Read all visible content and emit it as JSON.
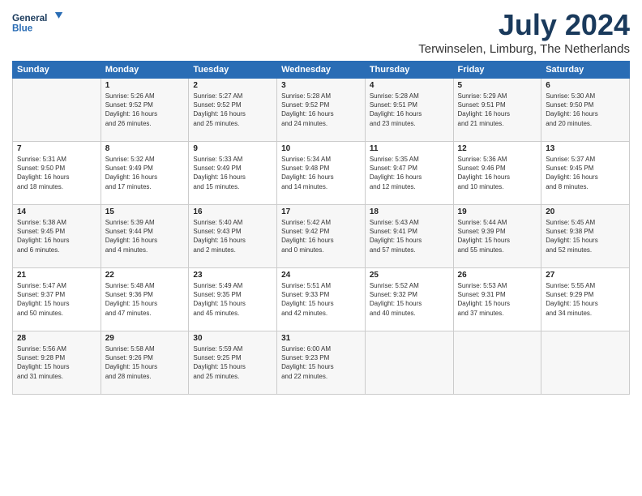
{
  "logo": {
    "line1": "General",
    "line2": "Blue"
  },
  "title": "July 2024",
  "subtitle": "Terwinselen, Limburg, The Netherlands",
  "weekdays": [
    "Sunday",
    "Monday",
    "Tuesday",
    "Wednesday",
    "Thursday",
    "Friday",
    "Saturday"
  ],
  "weeks": [
    [
      {
        "day": "",
        "content": ""
      },
      {
        "day": "1",
        "content": "Sunrise: 5:26 AM\nSunset: 9:52 PM\nDaylight: 16 hours\nand 26 minutes."
      },
      {
        "day": "2",
        "content": "Sunrise: 5:27 AM\nSunset: 9:52 PM\nDaylight: 16 hours\nand 25 minutes."
      },
      {
        "day": "3",
        "content": "Sunrise: 5:28 AM\nSunset: 9:52 PM\nDaylight: 16 hours\nand 24 minutes."
      },
      {
        "day": "4",
        "content": "Sunrise: 5:28 AM\nSunset: 9:51 PM\nDaylight: 16 hours\nand 23 minutes."
      },
      {
        "day": "5",
        "content": "Sunrise: 5:29 AM\nSunset: 9:51 PM\nDaylight: 16 hours\nand 21 minutes."
      },
      {
        "day": "6",
        "content": "Sunrise: 5:30 AM\nSunset: 9:50 PM\nDaylight: 16 hours\nand 20 minutes."
      }
    ],
    [
      {
        "day": "7",
        "content": "Sunrise: 5:31 AM\nSunset: 9:50 PM\nDaylight: 16 hours\nand 18 minutes."
      },
      {
        "day": "8",
        "content": "Sunrise: 5:32 AM\nSunset: 9:49 PM\nDaylight: 16 hours\nand 17 minutes."
      },
      {
        "day": "9",
        "content": "Sunrise: 5:33 AM\nSunset: 9:49 PM\nDaylight: 16 hours\nand 15 minutes."
      },
      {
        "day": "10",
        "content": "Sunrise: 5:34 AM\nSunset: 9:48 PM\nDaylight: 16 hours\nand 14 minutes."
      },
      {
        "day": "11",
        "content": "Sunrise: 5:35 AM\nSunset: 9:47 PM\nDaylight: 16 hours\nand 12 minutes."
      },
      {
        "day": "12",
        "content": "Sunrise: 5:36 AM\nSunset: 9:46 PM\nDaylight: 16 hours\nand 10 minutes."
      },
      {
        "day": "13",
        "content": "Sunrise: 5:37 AM\nSunset: 9:45 PM\nDaylight: 16 hours\nand 8 minutes."
      }
    ],
    [
      {
        "day": "14",
        "content": "Sunrise: 5:38 AM\nSunset: 9:45 PM\nDaylight: 16 hours\nand 6 minutes."
      },
      {
        "day": "15",
        "content": "Sunrise: 5:39 AM\nSunset: 9:44 PM\nDaylight: 16 hours\nand 4 minutes."
      },
      {
        "day": "16",
        "content": "Sunrise: 5:40 AM\nSunset: 9:43 PM\nDaylight: 16 hours\nand 2 minutes."
      },
      {
        "day": "17",
        "content": "Sunrise: 5:42 AM\nSunset: 9:42 PM\nDaylight: 16 hours\nand 0 minutes."
      },
      {
        "day": "18",
        "content": "Sunrise: 5:43 AM\nSunset: 9:41 PM\nDaylight: 15 hours\nand 57 minutes."
      },
      {
        "day": "19",
        "content": "Sunrise: 5:44 AM\nSunset: 9:39 PM\nDaylight: 15 hours\nand 55 minutes."
      },
      {
        "day": "20",
        "content": "Sunrise: 5:45 AM\nSunset: 9:38 PM\nDaylight: 15 hours\nand 52 minutes."
      }
    ],
    [
      {
        "day": "21",
        "content": "Sunrise: 5:47 AM\nSunset: 9:37 PM\nDaylight: 15 hours\nand 50 minutes."
      },
      {
        "day": "22",
        "content": "Sunrise: 5:48 AM\nSunset: 9:36 PM\nDaylight: 15 hours\nand 47 minutes."
      },
      {
        "day": "23",
        "content": "Sunrise: 5:49 AM\nSunset: 9:35 PM\nDaylight: 15 hours\nand 45 minutes."
      },
      {
        "day": "24",
        "content": "Sunrise: 5:51 AM\nSunset: 9:33 PM\nDaylight: 15 hours\nand 42 minutes."
      },
      {
        "day": "25",
        "content": "Sunrise: 5:52 AM\nSunset: 9:32 PM\nDaylight: 15 hours\nand 40 minutes."
      },
      {
        "day": "26",
        "content": "Sunrise: 5:53 AM\nSunset: 9:31 PM\nDaylight: 15 hours\nand 37 minutes."
      },
      {
        "day": "27",
        "content": "Sunrise: 5:55 AM\nSunset: 9:29 PM\nDaylight: 15 hours\nand 34 minutes."
      }
    ],
    [
      {
        "day": "28",
        "content": "Sunrise: 5:56 AM\nSunset: 9:28 PM\nDaylight: 15 hours\nand 31 minutes."
      },
      {
        "day": "29",
        "content": "Sunrise: 5:58 AM\nSunset: 9:26 PM\nDaylight: 15 hours\nand 28 minutes."
      },
      {
        "day": "30",
        "content": "Sunrise: 5:59 AM\nSunset: 9:25 PM\nDaylight: 15 hours\nand 25 minutes."
      },
      {
        "day": "31",
        "content": "Sunrise: 6:00 AM\nSunset: 9:23 PM\nDaylight: 15 hours\nand 22 minutes."
      },
      {
        "day": "",
        "content": ""
      },
      {
        "day": "",
        "content": ""
      },
      {
        "day": "",
        "content": ""
      }
    ]
  ]
}
